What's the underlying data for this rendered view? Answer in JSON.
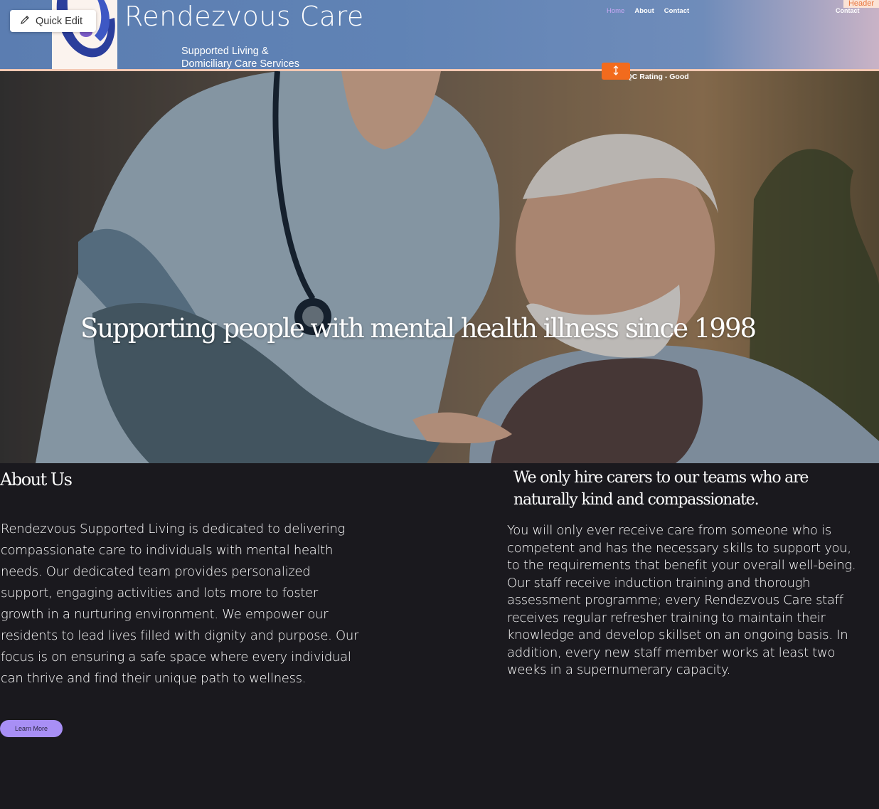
{
  "header": {
    "site_title": "Rendezvous Care",
    "tagline_line1": "Supported Living &",
    "tagline_line2": "Domiciliary Care Services",
    "nav": {
      "home": "Home",
      "about": "About",
      "contact": "Contact",
      "contact_right": "Contact"
    },
    "editor_tag": "Header",
    "quick_edit_label": "Quick Edit",
    "cqc_rating": "CQC Rating - Good"
  },
  "hero": {
    "headline": "Supporting people with mental health illness since 1998"
  },
  "about": {
    "heading": "About Us",
    "body": "Rendezvous Supported Living is dedicated to delivering compassionate care to individuals with mental health needs. Our dedicated team provides personalized support, engaging activities and lots more to foster growth in a nurturing environment. We empower our residents to lead lives filled with dignity and purpose. Our focus is on ensuring a safe space where every individual can thrive and find their unique path to wellness.",
    "button_label": "Learn More"
  },
  "hiring": {
    "heading": "We only hire carers to our teams who are naturally kind and compassionate.",
    "paragraph1": "You will only ever receive care from someone who is competent and has the necessary skills to support you, to the requirements that benefit your overall well-being.",
    "paragraph2": "Our staff receive induction training and thorough assessment programme; every Rendezvous Care staff receives regular refresher training to maintain their knowledge and develop skillset on an ongoing basis. In addition, every new staff member works at least two weeks in a supernumerary capacity."
  },
  "colors": {
    "header_bg": "#5b7db1",
    "page_bg": "#1a191e",
    "accent_purple": "#a88ff5",
    "active_nav": "#c9a9f5",
    "editor_orange": "#f26b1d"
  }
}
